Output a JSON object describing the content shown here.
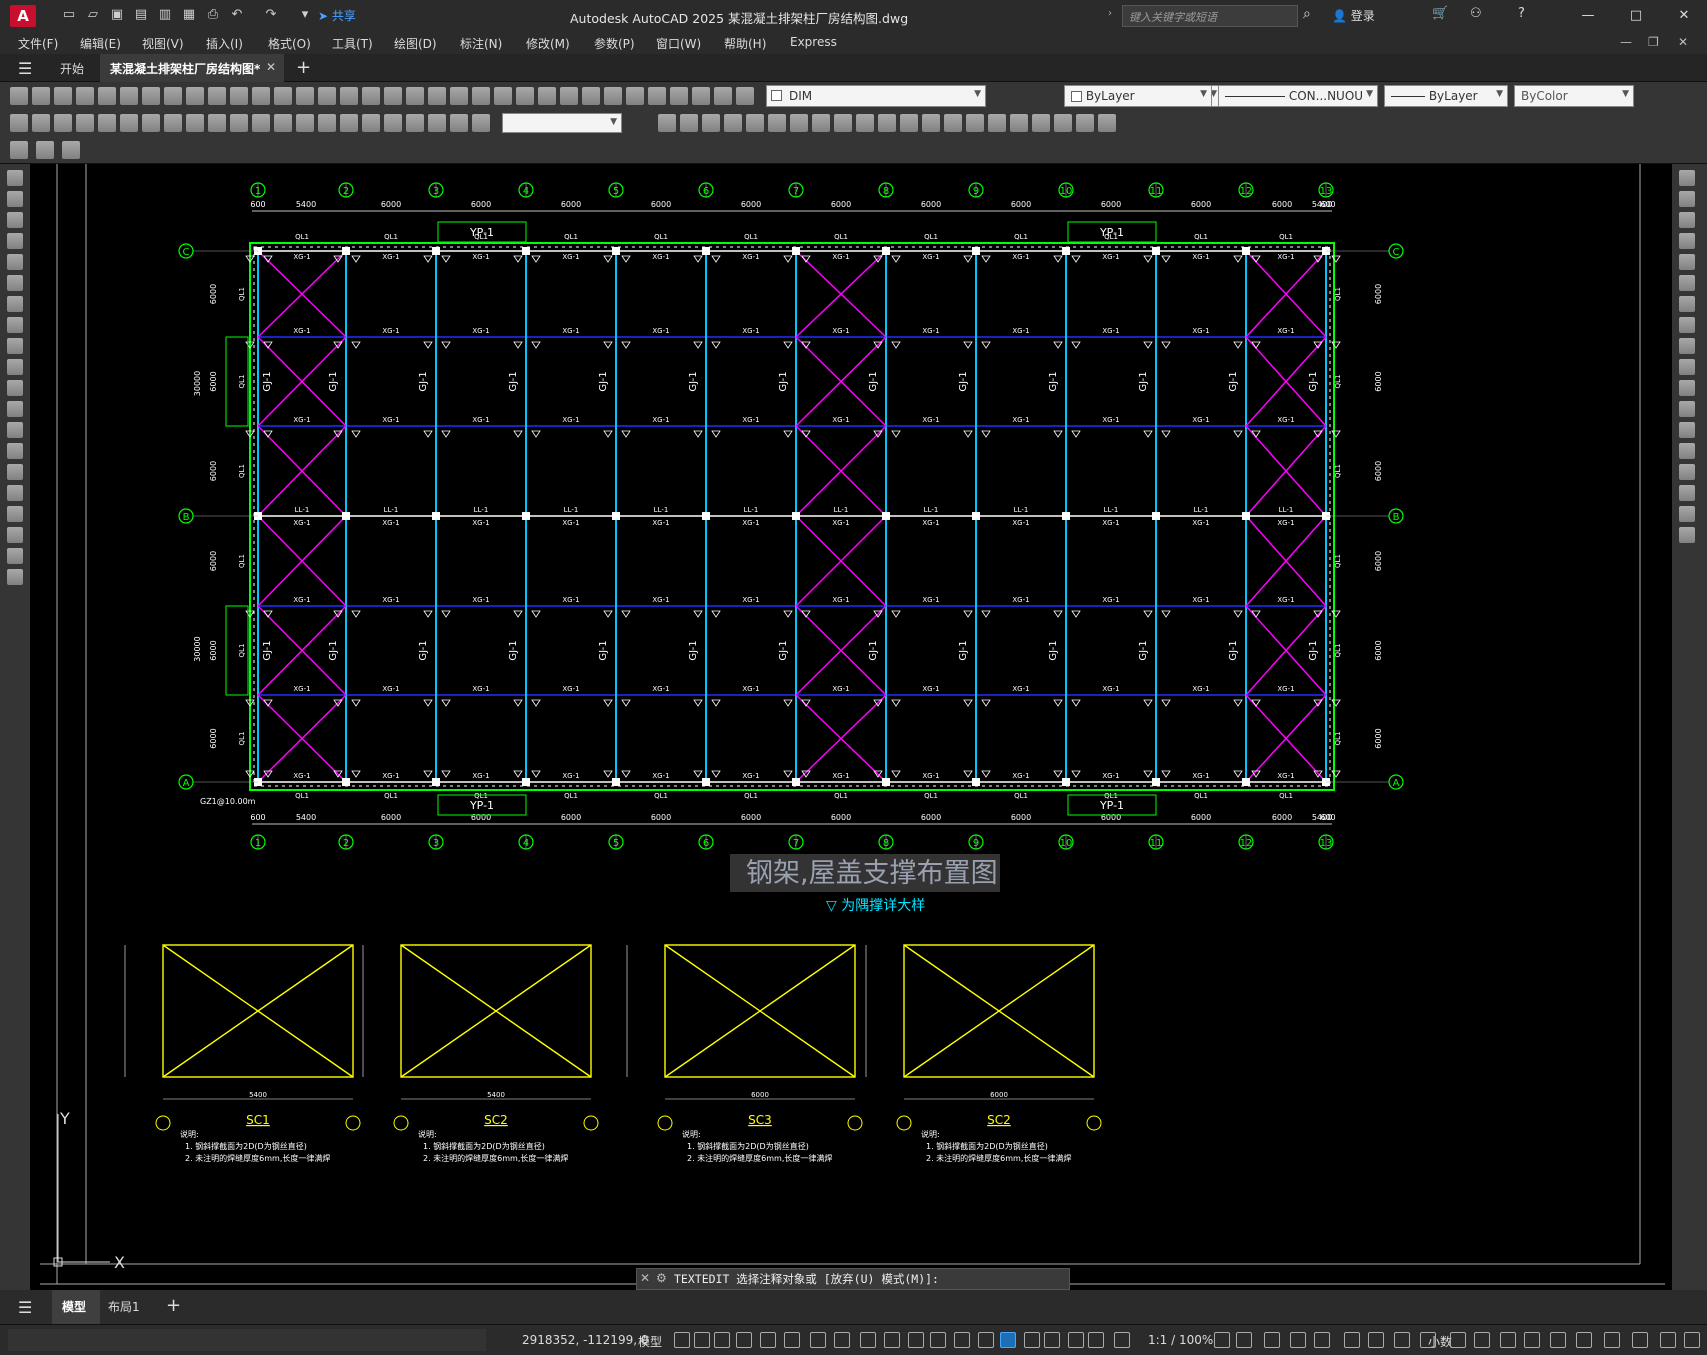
{
  "titlebar": {
    "app_letter": "A",
    "share_label": "共享",
    "title": "Autodesk AutoCAD 2025    某混凝土排架柱厂房结构图.dwg",
    "search_placeholder": "键入关键字或短语",
    "login_label": "登录"
  },
  "menubar": {
    "items": [
      "文件(F)",
      "编辑(E)",
      "视图(V)",
      "插入(I)",
      "格式(O)",
      "工具(T)",
      "绘图(D)",
      "标注(N)",
      "修改(M)",
      "参数(P)",
      "窗口(W)",
      "帮助(H)",
      "Express"
    ]
  },
  "tabs": {
    "home": "开始",
    "document": "某混凝土排架柱厂房结构图*"
  },
  "toolbar": {
    "layer_name": "DIM",
    "color": "ByLayer",
    "linetype": "CON...NUOU",
    "lineweight": "ByLayer",
    "plotstyle": "ByColor"
  },
  "drawing": {
    "title": "钢架,屋盖支撑布置图",
    "subtitle": "▽ 为隅撑详大样",
    "axis_numbers": [
      "1",
      "2",
      "3",
      "4",
      "5",
      "6",
      "7",
      "8",
      "9",
      "10",
      "11",
      "12",
      "13"
    ],
    "axis_letters": [
      "C",
      "B",
      "A"
    ],
    "top_dims": [
      "600",
      "5400",
      "6000",
      "6000",
      "6000",
      "6000",
      "6000",
      "6000",
      "6000",
      "6000",
      "6000",
      "6000",
      "6000",
      "5400",
      "600"
    ],
    "side_dims": [
      "6000",
      "6000",
      "6000",
      "6000",
      "6000",
      "6000"
    ],
    "total_dim": "30000",
    "frame_label": "GJ-1",
    "strut_label": "XG-1",
    "tie_label": "LL-1",
    "roof_panel": "YP-1",
    "ql_label": "QL1",
    "elevation": "GZ1@10.00m",
    "details": [
      {
        "name": "SC1",
        "note1": "1. 钢斜撑截面为2D(D为钢丝直径)",
        "note2": "2. 未注明的焊缝厚度6mm,长度一律满焊",
        "width": "5400"
      },
      {
        "name": "SC2",
        "note1": "1. 钢斜撑截面为2D(D为钢丝直径)",
        "note2": "2. 未注明的焊缝厚度6mm,长度一律满焊",
        "width": "5400"
      },
      {
        "name": "SC3",
        "note1": "1. 钢斜撑截面为2D(D为钢丝直径)",
        "note2": "2. 未注明的焊缝厚度6mm,长度一律满焊",
        "width": "6000"
      },
      {
        "name": "SC2",
        "note1": "1. 钢斜撑截面为2D(D为钢丝直径)",
        "note2": "2. 未注明的焊缝厚度6mm,长度一律满焊",
        "width": "6000"
      }
    ],
    "detail_note_head": "说明:",
    "ucs_x": "X",
    "ucs_y": "Y"
  },
  "command": {
    "text": "TEXTEDIT 选择注释对象或 [放弃(U) 模式(M)]:"
  },
  "layouts": {
    "model": "模型",
    "layout1": "布局1"
  },
  "status": {
    "coords": "2918352, -112199, 0",
    "model": "模型",
    "scale": "1:1 / 100%",
    "units": "小数"
  },
  "colors": {
    "grid": "#00c8ff",
    "brace": "#ff00ff",
    "strut": "#2030ff",
    "axis": "#00ff00",
    "detail": "#ffff00",
    "accent": "#c8102e"
  }
}
